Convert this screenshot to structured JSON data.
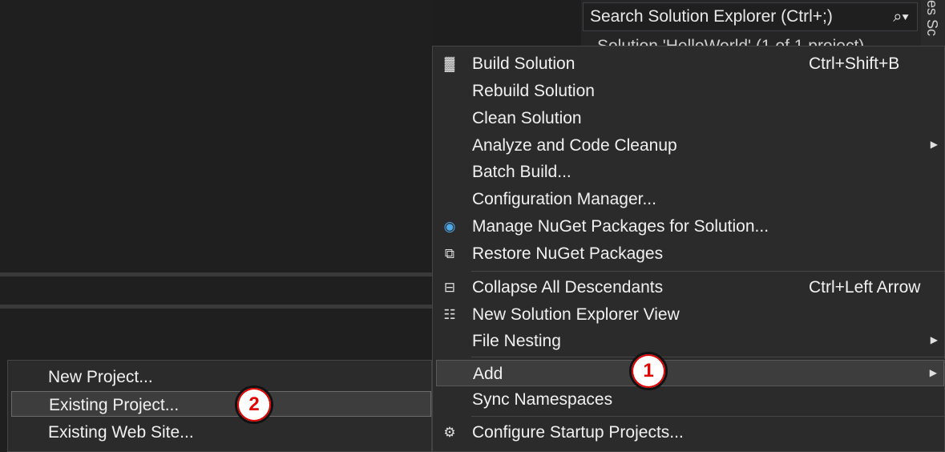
{
  "solution_explorer": {
    "search_placeholder": "Search Solution Explorer (Ctrl+;)",
    "search_icon": "search-icon",
    "tree_root_label": "Solution 'HelloWorld' (1 of 1 project)",
    "side_tab_label": "es  Sc"
  },
  "context_menu": {
    "items": [
      {
        "label": "Build Solution",
        "shortcut": "Ctrl+Shift+B",
        "icon": "build-icon"
      },
      {
        "label": "Rebuild Solution"
      },
      {
        "label": "Clean Solution"
      },
      {
        "label": "Analyze and Code Cleanup",
        "submenu": true
      },
      {
        "label": "Batch Build..."
      },
      {
        "label": "Configuration Manager..."
      },
      {
        "label": "Manage NuGet Packages for Solution...",
        "icon": "nuget-icon"
      },
      {
        "label": "Restore NuGet Packages",
        "icon": "restore-icon"
      },
      {
        "label": "Collapse All Descendants",
        "shortcut": "Ctrl+Left Arrow",
        "icon": "collapse-icon"
      },
      {
        "label": "New Solution Explorer View",
        "icon": "new-view-icon"
      },
      {
        "label": "File Nesting",
        "submenu": true
      },
      {
        "label": "Add",
        "submenu": true,
        "highlighted": true
      },
      {
        "label": "Sync Namespaces"
      },
      {
        "label": "Configure Startup Projects...",
        "icon": "gear-icon"
      }
    ]
  },
  "add_submenu": {
    "items": [
      {
        "label": "New Project..."
      },
      {
        "label": "Existing Project...",
        "highlighted": true
      },
      {
        "label": "Existing Web Site..."
      }
    ]
  },
  "callouts": [
    "1",
    "2"
  ]
}
